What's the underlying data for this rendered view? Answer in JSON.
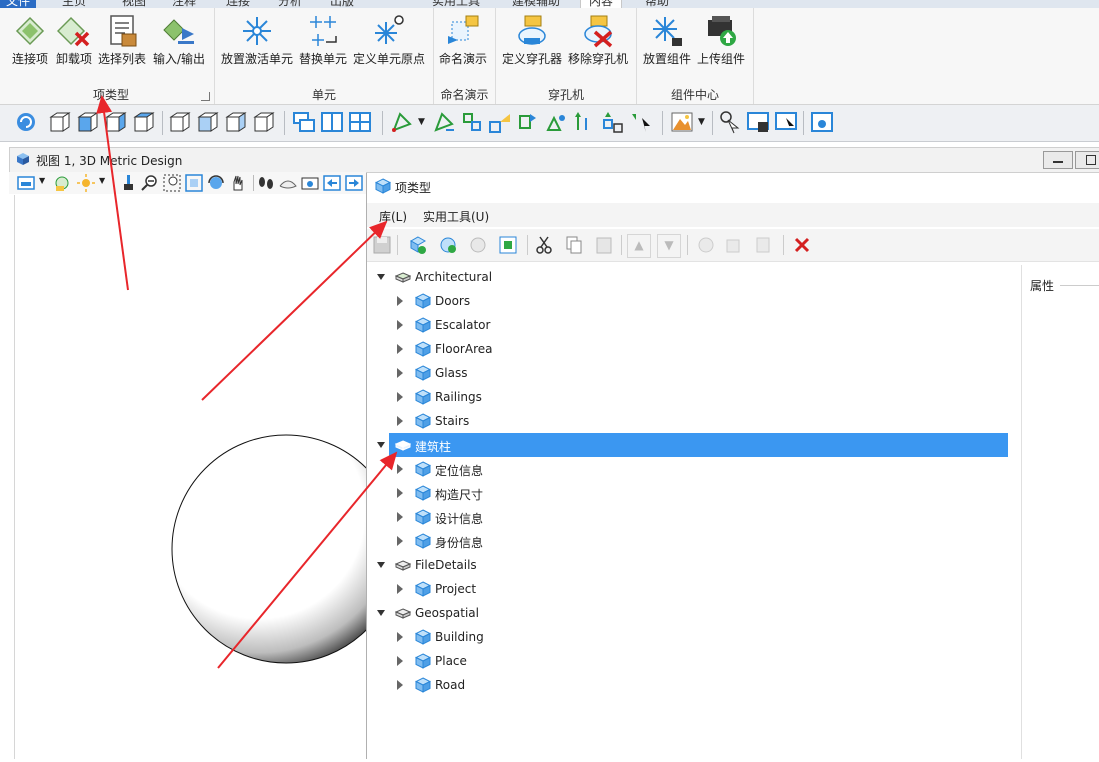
{
  "ribbon": {
    "tabs": [
      "文件",
      "主页",
      "视图",
      "注释",
      "连接",
      "分析",
      "出版",
      "实用工具",
      "建模辅助",
      "内容",
      "帮助"
    ],
    "groups": [
      {
        "label": "项类型",
        "buttons": [
          "连接项",
          "卸载项",
          "选择列表",
          "输入/输出"
        ]
      },
      {
        "label": "单元",
        "buttons": [
          "放置激活单元",
          "替换单元",
          "定义单元原点"
        ]
      },
      {
        "label": "命名演示",
        "buttons": [
          "命名演示"
        ]
      },
      {
        "label": "穿孔机",
        "buttons": [
          "定义穿孔器",
          "移除穿孔机"
        ]
      },
      {
        "label": "组件中心",
        "buttons": [
          "放置组件",
          "上传组件"
        ]
      }
    ]
  },
  "view": {
    "title": "视图 1, 3D Metric Design"
  },
  "dialog": {
    "title": "项类型",
    "menu": [
      "库(L)",
      "实用工具(U)"
    ],
    "properties_label": "属性",
    "tree": [
      {
        "label": "Architectural",
        "level": 0,
        "expanded": true,
        "selected": false
      },
      {
        "label": "Doors",
        "level": 1,
        "expanded": false,
        "selected": false
      },
      {
        "label": "Escalator",
        "level": 1,
        "expanded": false,
        "selected": false
      },
      {
        "label": "FloorArea",
        "level": 1,
        "expanded": false,
        "selected": false
      },
      {
        "label": "Glass",
        "level": 1,
        "expanded": false,
        "selected": false
      },
      {
        "label": "Railings",
        "level": 1,
        "expanded": false,
        "selected": false
      },
      {
        "label": "Stairs",
        "level": 1,
        "expanded": false,
        "selected": false
      },
      {
        "label": "建筑柱",
        "level": 0,
        "expanded": true,
        "selected": true
      },
      {
        "label": "定位信息",
        "level": 1,
        "expanded": false,
        "selected": false
      },
      {
        "label": "构造尺寸",
        "level": 1,
        "expanded": false,
        "selected": false
      },
      {
        "label": "设计信息",
        "level": 1,
        "expanded": false,
        "selected": false
      },
      {
        "label": "身份信息",
        "level": 1,
        "expanded": false,
        "selected": false
      },
      {
        "label": "FileDetails",
        "level": 0,
        "expanded": true,
        "selected": false
      },
      {
        "label": "Project",
        "level": 1,
        "expanded": false,
        "selected": false
      },
      {
        "label": "Geospatial",
        "level": 0,
        "expanded": true,
        "selected": false
      },
      {
        "label": "Building",
        "level": 1,
        "expanded": false,
        "selected": false
      },
      {
        "label": "Place",
        "level": 1,
        "expanded": false,
        "selected": false
      },
      {
        "label": "Road",
        "level": 1,
        "expanded": false,
        "selected": false
      }
    ]
  },
  "colors": {
    "selection": "#3b97f1",
    "annotation_arrow": "#e8262b",
    "file_tab": "#2b6cc4"
  }
}
